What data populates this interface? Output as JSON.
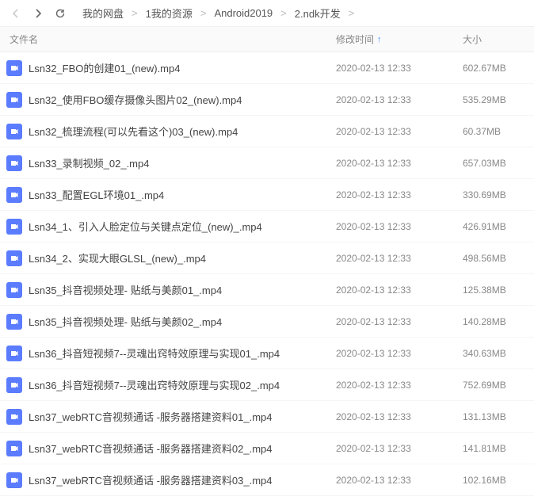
{
  "breadcrumbs": [
    "我的网盘",
    "1我的资源",
    "Android2019",
    "2.ndk开发"
  ],
  "columns": {
    "name": "文件名",
    "date": "修改时间",
    "size": "大小"
  },
  "files": [
    {
      "name": "Lsn32_FBO的创建01_(new).mp4",
      "date": "2020-02-13 12:33",
      "size": "602.67MB"
    },
    {
      "name": "Lsn32_使用FBO缓存摄像头图片02_(new).mp4",
      "date": "2020-02-13 12:33",
      "size": "535.29MB"
    },
    {
      "name": "Lsn32_梳理流程(可以先看这个)03_(new).mp4",
      "date": "2020-02-13 12:33",
      "size": "60.37MB"
    },
    {
      "name": "Lsn33_录制视频_02_.mp4",
      "date": "2020-02-13 12:33",
      "size": "657.03MB"
    },
    {
      "name": "Lsn33_配置EGL环境01_.mp4",
      "date": "2020-02-13 12:33",
      "size": "330.69MB"
    },
    {
      "name": "Lsn34_1、引入人脸定位与关键点定位_(new)_.mp4",
      "date": "2020-02-13 12:33",
      "size": "426.91MB"
    },
    {
      "name": "Lsn34_2、实现大眼GLSL_(new)_.mp4",
      "date": "2020-02-13 12:33",
      "size": "498.56MB"
    },
    {
      "name": "Lsn35_抖音视频处理- 贴纸与美颜01_.mp4",
      "date": "2020-02-13 12:33",
      "size": "125.38MB"
    },
    {
      "name": "Lsn35_抖音视频处理- 贴纸与美颜02_.mp4",
      "date": "2020-02-13 12:33",
      "size": "140.28MB"
    },
    {
      "name": "Lsn36_抖音短视频7--灵魂出窍特效原理与实现01_.mp4",
      "date": "2020-02-13 12:33",
      "size": "340.63MB"
    },
    {
      "name": "Lsn36_抖音短视频7--灵魂出窍特效原理与实现02_.mp4",
      "date": "2020-02-13 12:33",
      "size": "752.69MB"
    },
    {
      "name": "Lsn37_webRTC音视频通话 -服务器搭建资料01_.mp4",
      "date": "2020-02-13 12:33",
      "size": "131.13MB"
    },
    {
      "name": "Lsn37_webRTC音视频通话 -服务器搭建资料02_.mp4",
      "date": "2020-02-13 12:33",
      "size": "141.81MB"
    },
    {
      "name": "Lsn37_webRTC音视频通话 -服务器搭建资料03_.mp4",
      "date": "2020-02-13 12:33",
      "size": "102.16MB"
    }
  ]
}
